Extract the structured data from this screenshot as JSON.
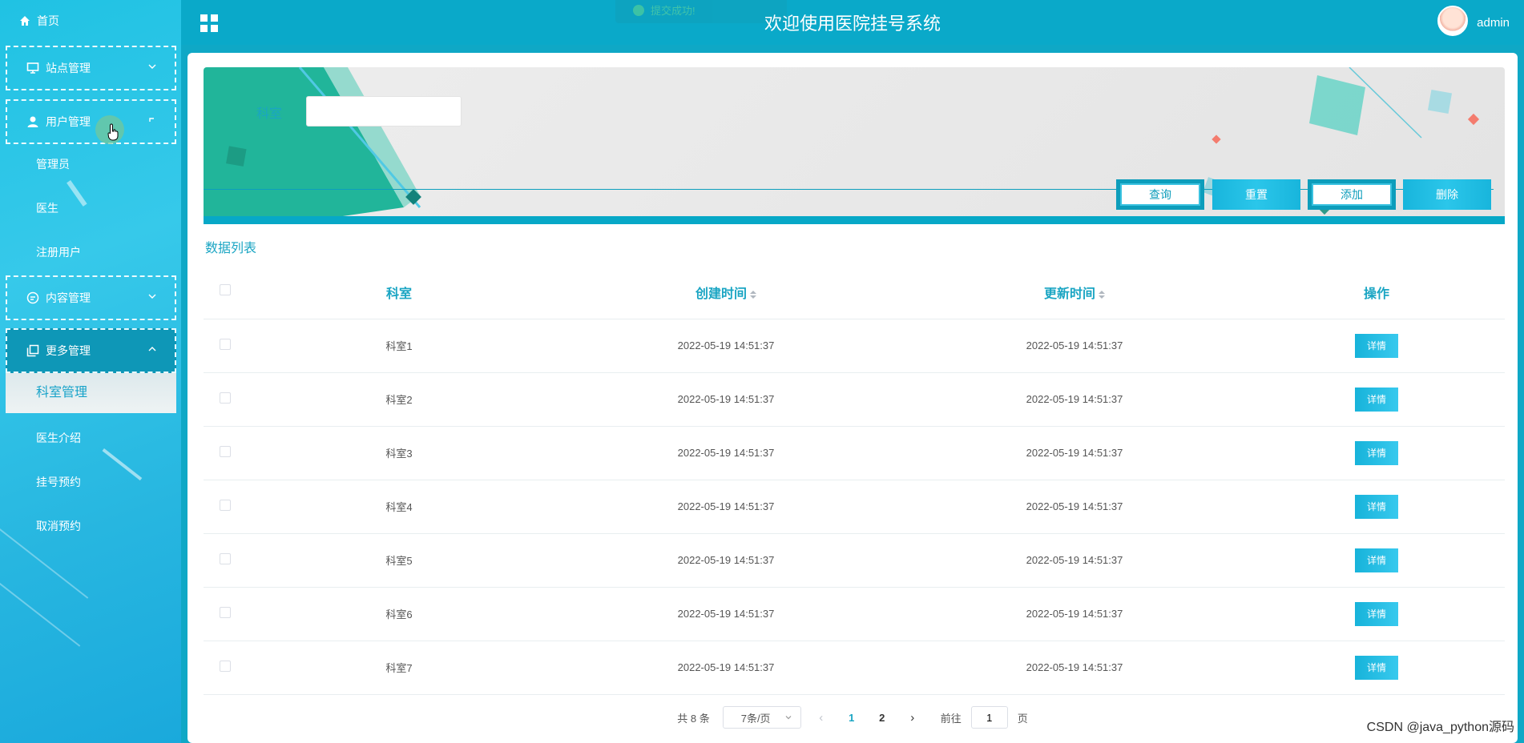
{
  "sidebar": {
    "home_label": "首页",
    "groups": [
      {
        "label": "站点管理",
        "expanded": false
      },
      {
        "label": "用户管理",
        "expanded": true
      },
      {
        "label": "内容管理",
        "expanded": false
      },
      {
        "label": "更多管理",
        "expanded": true
      }
    ],
    "user_items": [
      "管理员",
      "医生",
      "注册用户"
    ],
    "more_items": [
      "科室管理",
      "医生介绍",
      "挂号预约",
      "取消预约"
    ]
  },
  "header": {
    "title": "欢迎使用医院挂号系统",
    "toast": "提交成功!",
    "username": "admin"
  },
  "search": {
    "label": "科室",
    "value": "",
    "buttons": [
      "查询",
      "重置",
      "添加",
      "删除"
    ]
  },
  "list": {
    "title": "数据列表",
    "columns": [
      "科室",
      "创建时间",
      "更新时间",
      "操作"
    ],
    "action_label": "详情",
    "rows": [
      {
        "name": "科室1",
        "created": "2022-05-19 14:51:37",
        "updated": "2022-05-19 14:51:37"
      },
      {
        "name": "科室2",
        "created": "2022-05-19 14:51:37",
        "updated": "2022-05-19 14:51:37"
      },
      {
        "name": "科室3",
        "created": "2022-05-19 14:51:37",
        "updated": "2022-05-19 14:51:37"
      },
      {
        "name": "科室4",
        "created": "2022-05-19 14:51:37",
        "updated": "2022-05-19 14:51:37"
      },
      {
        "name": "科室5",
        "created": "2022-05-19 14:51:37",
        "updated": "2022-05-19 14:51:37"
      },
      {
        "name": "科室6",
        "created": "2022-05-19 14:51:37",
        "updated": "2022-05-19 14:51:37"
      },
      {
        "name": "科室7",
        "created": "2022-05-19 14:51:37",
        "updated": "2022-05-19 14:51:37"
      }
    ]
  },
  "pagination": {
    "total": "共 8 条",
    "page_size": "7条/页",
    "pages": [
      "1",
      "2"
    ],
    "current_page": "1",
    "goto_prefix": "前往",
    "goto_value": "1",
    "goto_suffix": "页"
  },
  "watermark": "CSDN @java_python源码",
  "colors": {
    "accent": "#0aa9c9",
    "sidebar": "#27b6e0",
    "label": "#1aa5c3"
  }
}
